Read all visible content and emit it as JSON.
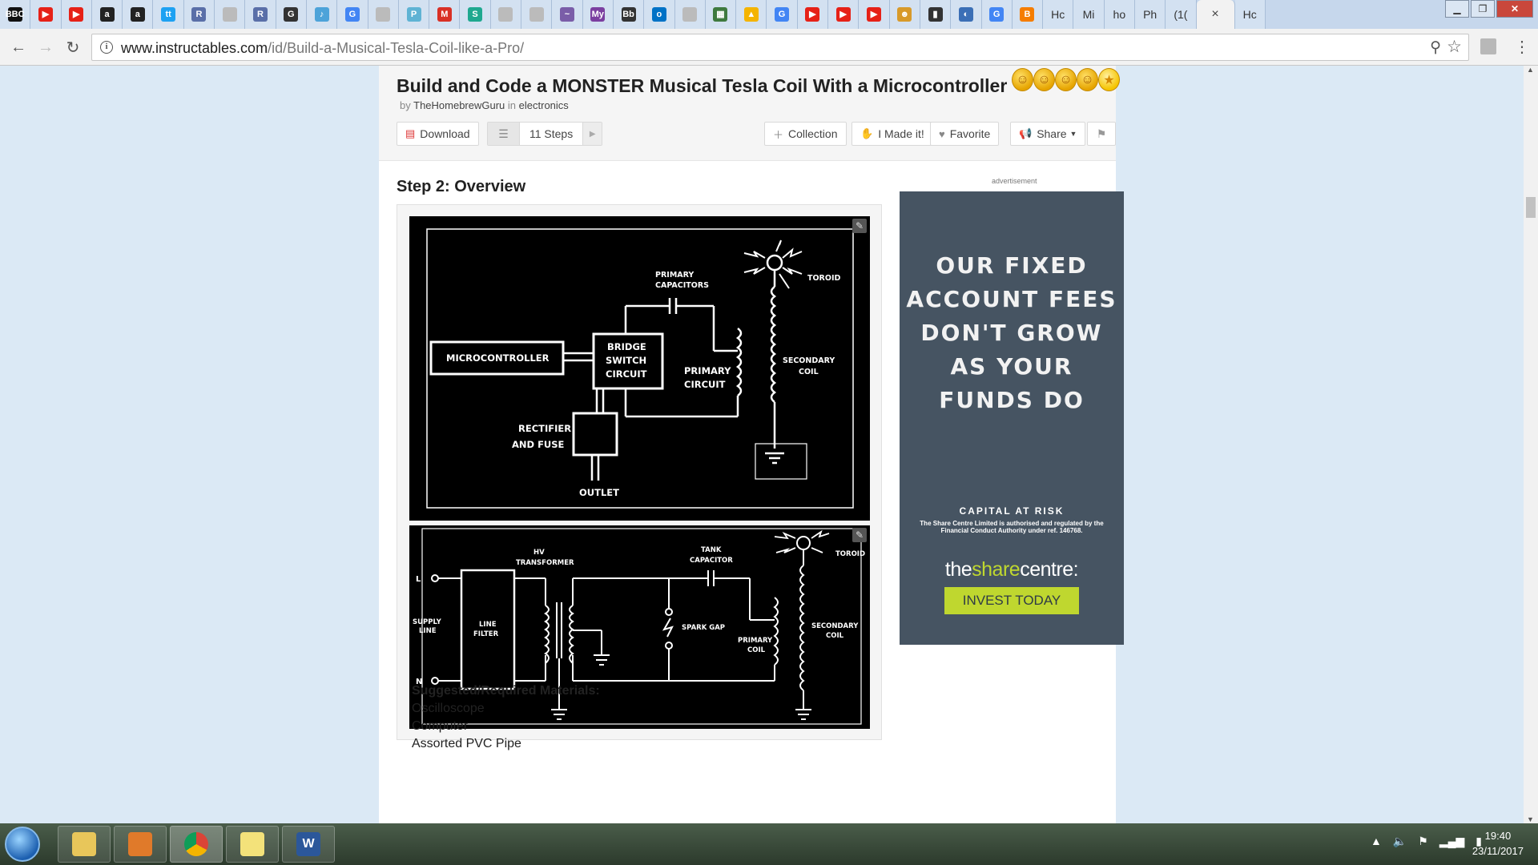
{
  "browser": {
    "tabs": [
      {
        "label": "BBC",
        "color": "#111111"
      },
      {
        "label": "▶",
        "color": "#e62117"
      },
      {
        "label": "▶",
        "color": "#e62117"
      },
      {
        "label": "a",
        "color": "#222222"
      },
      {
        "label": "a",
        "color": "#222222"
      },
      {
        "label": "tt",
        "color": "#1da1f2"
      },
      {
        "label": "R",
        "color": "#5a6fa8"
      },
      {
        "label": "",
        "color": "#bbbbbb"
      },
      {
        "label": "R",
        "color": "#5a6fa8"
      },
      {
        "label": "G",
        "color": "#333333"
      },
      {
        "label": "♪",
        "color": "#4da3d9"
      },
      {
        "label": "G",
        "color": "#4285f4"
      },
      {
        "label": "",
        "color": "#bbbbbb"
      },
      {
        "label": "P",
        "color": "#5fb3d4"
      },
      {
        "label": "M",
        "color": "#d93025"
      },
      {
        "label": "S",
        "color": "#1fa88f"
      },
      {
        "label": "",
        "color": "#bbbbbb"
      },
      {
        "label": "",
        "color": "#bbbbbb"
      },
      {
        "label": "~",
        "color": "#7a5da8"
      },
      {
        "label": "My",
        "color": "#7b3fa0"
      },
      {
        "label": "Bb",
        "color": "#333333"
      },
      {
        "label": "o",
        "color": "#0072c6"
      },
      {
        "label": "",
        "color": "#bbbbbb"
      },
      {
        "label": "▦",
        "color": "#3f7a3f"
      },
      {
        "label": "▲",
        "color": "#f4b400"
      },
      {
        "label": "G",
        "color": "#4285f4"
      },
      {
        "label": "▶",
        "color": "#e62117"
      },
      {
        "label": "▶",
        "color": "#e62117"
      },
      {
        "label": "▶",
        "color": "#e62117"
      },
      {
        "label": "☻",
        "color": "#d89a2a"
      },
      {
        "label": "▮",
        "color": "#333333"
      },
      {
        "label": "◐",
        "color": "#3b6fb6"
      },
      {
        "label": "G",
        "color": "#4285f4"
      },
      {
        "label": "B",
        "color": "#f57d00"
      }
    ],
    "text_tabs": [
      "Hc",
      "Mi",
      "ho",
      "Ph",
      "(1("
    ],
    "active_tab": {
      "label": "×"
    },
    "last_tab": "Hc",
    "url_domain": "www.instructables.com",
    "url_path": "/id/Build-a-Musical-Tesla-Coil-like-a-Pro/"
  },
  "page": {
    "title": "Build and Code a MONSTER Musical Tesla Coil With a Microcontroller",
    "by": "by",
    "author": "TheHomebrewGuru",
    "in": "in",
    "category": "electronics",
    "buttons": {
      "download": "Download",
      "steps": "11 Steps",
      "collection": "Collection",
      "made_it": "I Made it!",
      "favorite": "Favorite",
      "share": "Share"
    },
    "step_title": "Step 2: Overview",
    "diagram1": {
      "microcontroller": "MICROCONTROLLER",
      "bridge1": "BRIDGE",
      "bridge2": "SWITCH",
      "bridge3": "CIRCUIT",
      "primary_caps1": "PRIMARY",
      "primary_caps2": "CAPACITORS",
      "primary_circuit1": "PRIMARY",
      "primary_circuit2": "CIRCUIT",
      "secondary1": "SECONDARY",
      "secondary2": "COIL",
      "toroid": "TOROID",
      "rectifier1": "RECTIFIER",
      "rectifier2": "AND FUSE",
      "outlet": "OUTLET"
    },
    "diagram2": {
      "l": "L",
      "n": "N",
      "supply1": "SUPPLY",
      "supply2": "LINE",
      "filter1": "LINE",
      "filter2": "FILTER",
      "hv1": "HV",
      "hv2": "TRANSFORMER",
      "tank1": "TANK",
      "tank2": "CAPACITOR",
      "spark": "SPARK GAP",
      "primary1": "PRIMARY",
      "primary2": "COIL",
      "secondary1": "SECONDARY",
      "secondary2": "COIL",
      "toroid": "TOROID"
    },
    "ad": {
      "label": "advertisement",
      "headline": [
        "OUR FIXED",
        "ACCOUNT FEES",
        "DON'T GROW",
        "AS YOUR",
        "FUNDS DO"
      ],
      "risk": "CAPITAL AT RISK",
      "small": "The Share Centre Limited is authorised and regulated by the Financial Conduct Authority under ref. 146768.",
      "brand_pre": "the",
      "brand_mid": "share",
      "brand_post": "centre:",
      "cta": "INVEST TODAY",
      "bg_color": "#465462",
      "accent_color": "#bfd72f"
    },
    "materials": {
      "heading": "Suggested/Required Materials:",
      "items": [
        "Oscilloscope",
        "Computer",
        "Assorted PVC Pipe"
      ]
    }
  },
  "taskbar": {
    "time": "19:40",
    "date": "23/11/2017"
  }
}
